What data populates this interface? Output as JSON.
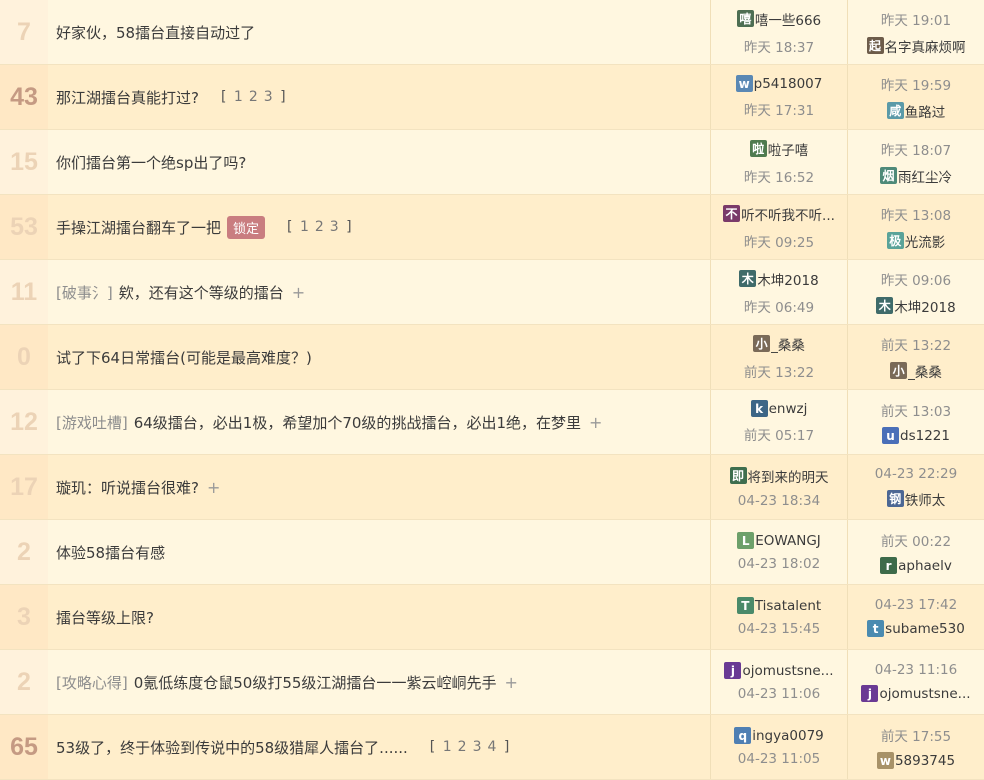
{
  "threads": [
    {
      "count": "7",
      "hot": false,
      "cat": "",
      "title": "好家伙，58擂台直接自动过了",
      "lock": "",
      "pages": [],
      "plus": false,
      "author": {
        "avatar": "嘻",
        "color": "#4d6e52",
        "name": "嘻一些666",
        "time": "昨天 18:37"
      },
      "reply": {
        "time": "昨天 19:01",
        "avatar": "起",
        "color": "#6d5c4a",
        "name": "名字真麻烦啊"
      }
    },
    {
      "count": "43",
      "hot": true,
      "cat": "",
      "title": "那江湖擂台真能打过?",
      "lock": "",
      "pages": [
        "1",
        "2",
        "3"
      ],
      "plus": false,
      "author": {
        "avatar": "w",
        "color": "#5a88b4",
        "name": "p5418007",
        "time": "昨天 17:31"
      },
      "reply": {
        "time": "昨天 19:59",
        "avatar": "咸",
        "color": "#5b9aa8",
        "name": "鱼路过"
      }
    },
    {
      "count": "15",
      "hot": false,
      "cat": "",
      "title": "你们擂台第一个绝sp出了吗?",
      "lock": "",
      "pages": [],
      "plus": false,
      "author": {
        "avatar": "啦",
        "color": "#4f7b4f",
        "name": "啦子嘻",
        "time": "昨天 16:52"
      },
      "reply": {
        "time": "昨天 18:07",
        "avatar": "烟",
        "color": "#4e8a79",
        "name": "雨红尘冷"
      }
    },
    {
      "count": "53",
      "hot": false,
      "cat": "",
      "title": "手操江湖擂台翻车了一把",
      "lock": "锁定",
      "pages": [
        "1",
        "2",
        "3"
      ],
      "plus": false,
      "author": {
        "avatar": "不",
        "color": "#7a3a6a",
        "name": "听不听我不听...",
        "time": "昨天 09:25"
      },
      "reply": {
        "time": "昨天 13:08",
        "avatar": "极",
        "color": "#5aa399",
        "name": "光流影"
      }
    },
    {
      "count": "11",
      "hot": false,
      "cat": "[破事氵]",
      "title": "欸，还有这个等级的擂台",
      "lock": "",
      "pages": [],
      "plus": true,
      "author": {
        "avatar": "木",
        "color": "#3f6b6a",
        "name": "木坤2018",
        "time": "昨天 06:49"
      },
      "reply": {
        "time": "昨天 09:06",
        "avatar": "木",
        "color": "#3f6b6a",
        "name": "木坤2018"
      }
    },
    {
      "count": "0",
      "hot": false,
      "cat": "",
      "title": "试了下64日常擂台(可能是最高难度？)",
      "lock": "",
      "pages": [],
      "plus": false,
      "author": {
        "avatar": "小",
        "color": "#7a6a58",
        "name": "_桑桑",
        "time": "前天 13:22"
      },
      "reply": {
        "time": "前天 13:22",
        "avatar": "小",
        "color": "#7a6a58",
        "name": "_桑桑"
      }
    },
    {
      "count": "12",
      "hot": false,
      "cat": "[游戏吐槽]",
      "title": "64级擂台，必出1极，希望加个70级的挑战擂台，必出1绝，在梦里",
      "lock": "",
      "pages": [],
      "plus": true,
      "author": {
        "avatar": "k",
        "color": "#3d6686",
        "name": "enwzj",
        "time": "前天 05:17"
      },
      "reply": {
        "time": "前天 13:03",
        "avatar": "u",
        "color": "#4a6fb8",
        "name": "ds1221"
      }
    },
    {
      "count": "17",
      "hot": false,
      "cat": "",
      "title": "璇玑：听说擂台很难?",
      "lock": "",
      "pages": [],
      "plus": true,
      "author": {
        "avatar": "即",
        "color": "#3e6e4e",
        "name": "将到来的明天",
        "time": "04-23 18:34"
      },
      "reply": {
        "time": "04-23 22:29",
        "avatar": "钢",
        "color": "#4c6794",
        "name": "铁师太"
      }
    },
    {
      "count": "2",
      "hot": false,
      "cat": "",
      "title": "体验58擂台有感",
      "lock": "",
      "pages": [],
      "plus": false,
      "author": {
        "avatar": "L",
        "color": "#6da06a",
        "name": "EOWANGJ",
        "time": "04-23 18:02"
      },
      "reply": {
        "time": "前天 00:22",
        "avatar": "r",
        "color": "#3d6b4a",
        "name": "aphaelv"
      }
    },
    {
      "count": "3",
      "hot": false,
      "cat": "",
      "title": "擂台等级上限?",
      "lock": "",
      "pages": [],
      "plus": false,
      "author": {
        "avatar": "T",
        "color": "#4a8a6a",
        "name": "Tisatalent",
        "time": "04-23 15:45"
      },
      "reply": {
        "time": "04-23 17:42",
        "avatar": "t",
        "color": "#4b8bb0",
        "name": "subame530"
      }
    },
    {
      "count": "2",
      "hot": false,
      "cat": "[攻略心得]",
      "title": "0氪低练度仓鼠50级打55级江湖擂台一一紫云崆峒先手",
      "lock": "",
      "pages": [],
      "plus": true,
      "author": {
        "avatar": "j",
        "color": "#6a3a94",
        "name": "ojomustsne...",
        "time": "04-23 11:06"
      },
      "reply": {
        "time": "04-23 11:16",
        "avatar": "j",
        "color": "#6a3a94",
        "name": "ojomustsne..."
      }
    },
    {
      "count": "65",
      "hot": true,
      "cat": "",
      "title": "53级了，终于体验到传说中的58级猎犀人擂台了......",
      "lock": "",
      "pages": [
        "1",
        "2",
        "3",
        "4"
      ],
      "plus": false,
      "author": {
        "avatar": "q",
        "color": "#4f7fb3",
        "name": "ingya0079",
        "time": "04-23 11:05"
      },
      "reply": {
        "time": "前天 17:55",
        "avatar": "w",
        "color": "#a89268",
        "name": "5893745"
      }
    }
  ]
}
